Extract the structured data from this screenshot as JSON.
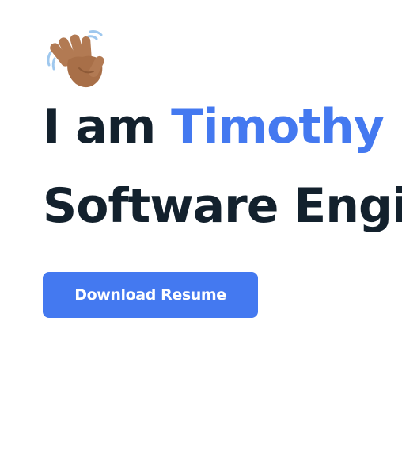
{
  "hero": {
    "greeting_icon": "waving-hand-icon",
    "headline_prefix": "I am ",
    "name": "Timothy",
    "role": "Software Engineer",
    "download_button_label": "Download Resume"
  },
  "colors": {
    "accent": "#4479f0",
    "heading": "#13212d",
    "background": "#ffffff",
    "button_text": "#ffffff"
  }
}
